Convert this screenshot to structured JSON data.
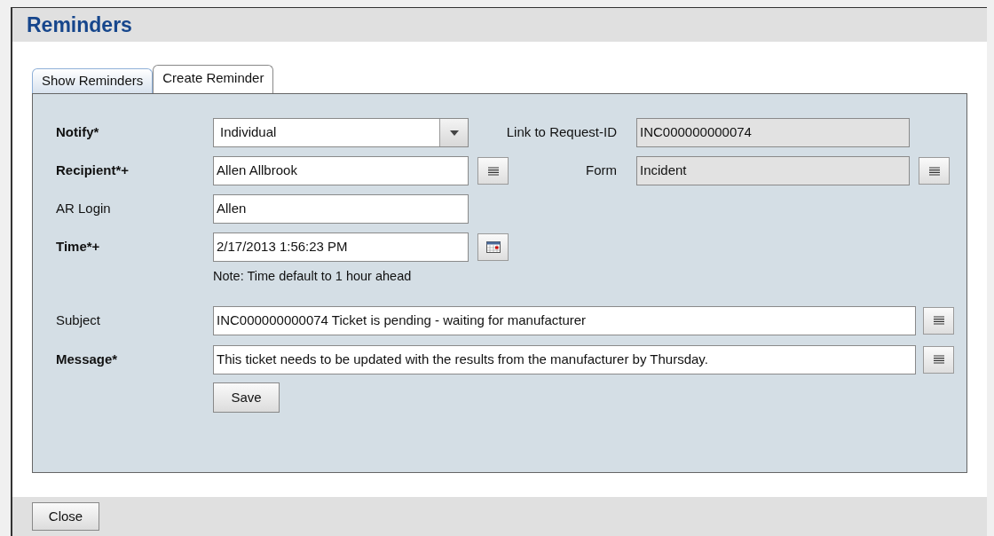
{
  "window": {
    "title": "Reminders"
  },
  "tabs": [
    {
      "label": "Show Reminders",
      "selected": false
    },
    {
      "label": "Create Reminder",
      "selected": true
    }
  ],
  "rows": [
    {
      "label": "Notify*",
      "bold": true,
      "kind": "dropdown",
      "value": "Individual",
      "side": {
        "label": "Link to Request-ID",
        "value": "INC000000000074"
      }
    },
    {
      "label": "Recipient*+",
      "bold": true,
      "kind": "text",
      "value": "Allen Allbrook",
      "list_button": true,
      "side": {
        "label": "Form",
        "value": "Incident",
        "list_button": true
      }
    },
    {
      "label": "AR Login",
      "bold": false,
      "kind": "text",
      "value": "Allen"
    },
    {
      "label": "Time*+",
      "bold": true,
      "kind": "text",
      "value": "2/17/2013 1:56:23 PM",
      "calendar_button": true,
      "note": "Note: Time default to 1 hour ahead"
    }
  ],
  "wide_rows": [
    {
      "label": "Subject",
      "bold": false,
      "value": "INC000000000074 Ticket is pending - waiting for manufacturer",
      "list_button": true
    },
    {
      "label": "Message*",
      "bold": true,
      "value": "This ticket needs to be updated with the results from the manufacturer by Thursday.",
      "list_button": true
    }
  ],
  "save_button": "Save",
  "close_button": "Close"
}
